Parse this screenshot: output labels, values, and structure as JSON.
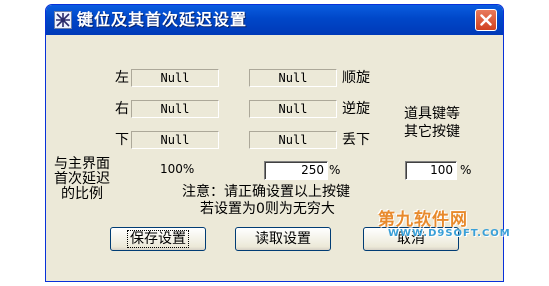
{
  "window": {
    "title": "键位及其首次延迟设置",
    "icon": "app-icon",
    "close_icon": "close-icon",
    "colors": {
      "titlebar": "#0047c8",
      "face": "#ece9d8",
      "close": "#d1411f"
    }
  },
  "rows": [
    {
      "left_label": "左",
      "left_value": "Null",
      "right_value": "Null",
      "right_label": "顺旋"
    },
    {
      "left_label": "右",
      "left_value": "Null",
      "right_value": "Null",
      "right_label": "逆旋"
    },
    {
      "left_label": "下",
      "left_value": "Null",
      "right_value": "Null",
      "right_label": "丢下"
    }
  ],
  "item_keys": {
    "line1": "道具键等",
    "line2": "其它按键"
  },
  "ratio": {
    "label_lines": [
      "与主界面",
      "首次延迟",
      "的比例"
    ],
    "main_value": "100%",
    "first_delay_value": "250",
    "first_delay_unit": "%",
    "item_value": "100",
    "item_unit": "%"
  },
  "notice": {
    "line1": "注意：请正确设置以上按键",
    "line2": "若设置为0则为无穷大"
  },
  "buttons": {
    "save": "保存设置",
    "load": "读取设置",
    "cancel": "取消"
  },
  "watermark": {
    "main": "第九软件网",
    "sub": "WWW.D9SOFT.COM"
  }
}
